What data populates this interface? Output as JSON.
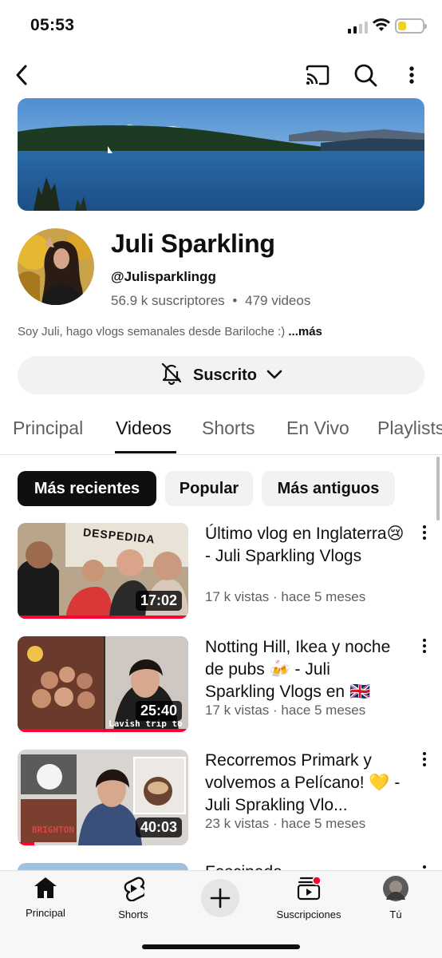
{
  "status": {
    "time": "05:53"
  },
  "topbar": {
    "back_icon": "back-arrow-icon",
    "cast_icon": "cast-icon",
    "search_icon": "search-icon",
    "more_icon": "more-vert-icon"
  },
  "channel": {
    "name": "Juli Sparkling",
    "handle": "@Julisparklingg",
    "subscribers": "56.9 k suscriptores",
    "separator": "•",
    "videos": "479 videos",
    "description": "Soy Juli, hago vlogs semanales desde Bariloche :)",
    "more": "...más",
    "subscribe_label": "Suscrito"
  },
  "tabs": [
    {
      "label": "Principal"
    },
    {
      "label": "Videos"
    },
    {
      "label": "Shorts"
    },
    {
      "label": "En Vivo"
    },
    {
      "label": "Playlists"
    }
  ],
  "chips": [
    {
      "label": "Más recientes"
    },
    {
      "label": "Popular"
    },
    {
      "label": "Más antiguos"
    }
  ],
  "videos": [
    {
      "title": "Último vlog en Inglaterra😢 - Juli Sparkling Vlogs",
      "meta": "17 k vistas · hace 5 meses",
      "duration": "17:02",
      "overlay_text": "DESPEDIDA",
      "watched": 1.0
    },
    {
      "title": "Notting Hill, Ikea y noche de pubs 🍻 - Juli Sparkling Vlogs en 🇬🇧",
      "meta": "17 k vistas · hace 5 meses",
      "duration": "25:40",
      "overlay_text": "Lavish trip to London",
      "watched": 1.0
    },
    {
      "title": "Recorremos Primark y volvemos a Pelícano! 💛 - Juli Sprakling Vlo...",
      "meta": "23 k vistas · hace 5 meses",
      "duration": "40:03",
      "overlay_text": "BRIGHTON",
      "watched": 0.1
    },
    {
      "title": "Fascinada",
      "meta": "",
      "duration": "",
      "overlay_text": "",
      "watched": 0
    }
  ],
  "bottom_nav": [
    {
      "label": "Principal",
      "icon": "home-icon"
    },
    {
      "label": "Shorts",
      "icon": "shorts-icon"
    },
    {
      "label": "",
      "icon": "create-plus-icon"
    },
    {
      "label": "Suscripciones",
      "icon": "subscriptions-icon"
    },
    {
      "label": "Tú",
      "icon": "profile-avatar"
    }
  ],
  "colors": {
    "accent": "#ff0033",
    "chip_selected": "#0f0f0f",
    "muted_text": "#606060"
  }
}
